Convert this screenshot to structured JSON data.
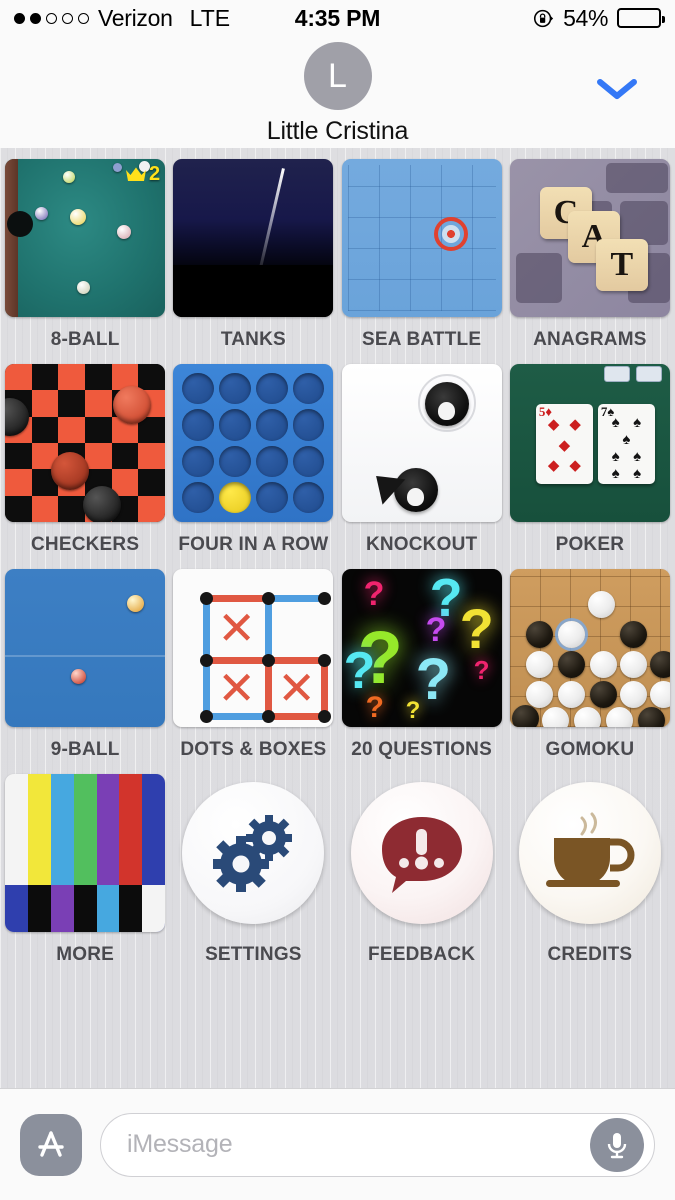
{
  "status_bar": {
    "signal_dots_filled": 2,
    "signal_dots_total": 5,
    "carrier": "Verizon",
    "network": "LTE",
    "time": "4:35 PM",
    "rotation_lock_icon": "rotation-lock-icon",
    "battery_percent_label": "54%",
    "battery_level": 54
  },
  "header": {
    "avatar_initial": "L",
    "contact_name": "Little Cristina",
    "collapse_icon": "chevron-down-icon",
    "accent_color": "#3478f6"
  },
  "app_drawer": {
    "games": [
      {
        "id": "8-ball",
        "label": "8-BALL",
        "badge": "2",
        "badge_icon": "crown-icon"
      },
      {
        "id": "tanks",
        "label": "TANKS"
      },
      {
        "id": "sea-battle",
        "label": "SEA BATTLE"
      },
      {
        "id": "anagrams",
        "label": "ANAGRAMS",
        "tiles": [
          "C",
          "A",
          "T"
        ]
      },
      {
        "id": "checkers",
        "label": "CHECKERS"
      },
      {
        "id": "four-in-a-row",
        "label": "FOUR IN A ROW"
      },
      {
        "id": "knockout",
        "label": "KNOCKOUT"
      },
      {
        "id": "poker",
        "label": "POKER",
        "cards": [
          "5♦",
          "7♠"
        ]
      },
      {
        "id": "9-ball",
        "label": "9-BALL"
      },
      {
        "id": "dots-and-boxes",
        "label": "DOTS & BOXES"
      },
      {
        "id": "20-questions",
        "label": "20 QUESTIONS"
      },
      {
        "id": "gomoku",
        "label": "GOMOKU"
      },
      {
        "id": "more",
        "label": "MORE",
        "icon": "color-bars-icon"
      },
      {
        "id": "settings",
        "label": "SETTINGS",
        "icon": "gears-icon"
      },
      {
        "id": "feedback",
        "label": "FEEDBACK",
        "icon": "speech-bubble-icon"
      },
      {
        "id": "credits",
        "label": "CREDITS",
        "icon": "coffee-cup-icon"
      }
    ]
  },
  "input_bar": {
    "app_store_icon": "app-store-icon",
    "message_placeholder": "iMessage",
    "message_value": "",
    "mic_icon": "microphone-icon"
  },
  "colors": {
    "ios_blue": "#3478f6",
    "label_grey": "#4a4a4f",
    "drawer_bg": "#dedee1",
    "chrome_bg": "#fafafa"
  }
}
